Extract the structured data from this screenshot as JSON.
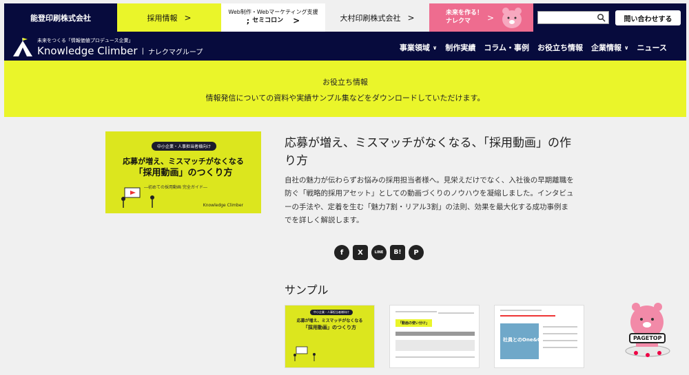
{
  "topbar": {
    "company": "能登印刷株式会社",
    "recruit": "採用情報",
    "semi_top": "Web制作・Webマーケティング支援",
    "semi_bottom": "セミコロン",
    "omura": "大村印刷株式会社",
    "narekuma_line1": "未来を作る！",
    "narekuma_line2": "ナレクマ",
    "search_placeholder": "",
    "contact": "問い合わせする",
    "arrow": ">"
  },
  "header": {
    "tagline": "未来をつくる「情報価値プロデュース企業」",
    "brand": "Knowledge Climber",
    "separator": "|",
    "group": "ナレクマグループ",
    "nav": [
      {
        "label": "事業領域",
        "dropdown": true
      },
      {
        "label": "制作実績",
        "dropdown": false
      },
      {
        "label": "コラム・事例",
        "dropdown": false
      },
      {
        "label": "お役立ち情報",
        "dropdown": false
      },
      {
        "label": "企業情報",
        "dropdown": true
      },
      {
        "label": "ニュース",
        "dropdown": false
      }
    ]
  },
  "hero": {
    "title": "お役立ち情報",
    "description": "情報発信についての資料や実績サンプル集などをダウンロードしていただけます。"
  },
  "thumbnail": {
    "badge": "中小企業・人事担当者様向け",
    "line1": "応募が増え、ミスマッチがなくなる",
    "line2": "「採用動画」のつくり方",
    "subtitle": "―初めての採用動画 完全ガイド―",
    "logo": "Knowledge Climber"
  },
  "article": {
    "title": "応募が増え、ミスマッチがなくなる、「採用動画」の作り方",
    "body": "自社の魅力が伝わらずお悩みの採用担当者様へ。見栄えだけでなく、入社後の早期離職を防ぐ「戦略的採用アセット」としての動画づくりのノウハウを凝縮しました。インタビューの手法や、定着を生む「魅力7割・リアル3割」の法則、効果を最大化する成功事例までを詳しく解説します。"
  },
  "share": {
    "facebook": "f",
    "x": "X",
    "line": "LINE",
    "hatena": "B!",
    "pinterest": "P"
  },
  "samples": {
    "title": "サンプル",
    "s1_badge": "中小企業・人事担当者様向け",
    "s1_line1": "応募が増え、ミスマッチがなくなる",
    "s1_line2": "「採用動画」のつくり方",
    "s2_banner": "「動画の使い分け」",
    "s3_banner": "社員とのOne&One"
  },
  "pagetop": {
    "label": "PAGETOP"
  },
  "colors": {
    "navy": "#070b3d",
    "lime": "#eaf52a",
    "pink": "#ee6c8f"
  }
}
